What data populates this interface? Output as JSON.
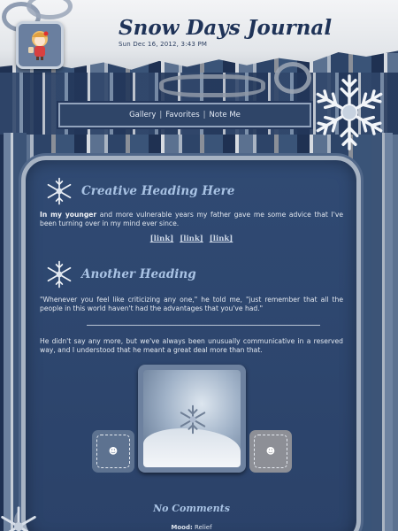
{
  "header": {
    "title": "Snow Days Journal",
    "date": "Sun Dec 16, 2012, 3:43 PM"
  },
  "nav": {
    "items": [
      {
        "label": "Gallery"
      },
      {
        "label": "Favorites"
      },
      {
        "label": "Note Me"
      }
    ],
    "separator": "|"
  },
  "sections": [
    {
      "heading": "Creative Heading Here",
      "bold_lead": "In my younger",
      "text": " and more vulnerable years my father gave me some advice that I've been turning over in my mind ever since.",
      "links": [
        "[link]",
        "[link]",
        "[link]"
      ]
    },
    {
      "heading": "Another Heading",
      "quote": "\"Whenever you feel like criticizing any one,\" he told me, \"just remember that all the people in this world haven't had the advantages that you've had.\"",
      "after_rule": "He didn't say any more, but we've always been unusually communicative in a reserved way, and I understood that he meant a great deal more than that."
    }
  ],
  "footer": {
    "comments": "No Comments",
    "mood_label": "Mood:",
    "mood_value": "Relief"
  },
  "icons": {
    "avatar": "chibi-avatar-icon",
    "heading": "snowflake-icon",
    "tiles": "smiley-icon"
  },
  "colors": {
    "background": "#2b3f62",
    "panel": "#304a73",
    "heading": "#a9c3e4",
    "title": "#1f3358"
  }
}
